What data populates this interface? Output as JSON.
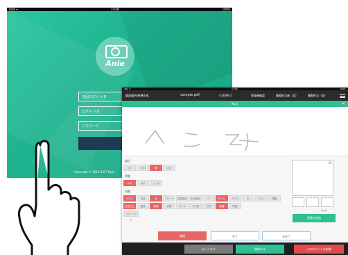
{
  "login": {
    "status_time": "14:08",
    "status_left": "iPad ᯤ",
    "status_right": "100%",
    "logo_text": "Anie",
    "field1_placeholder": "前回ログインID",
    "field2_placeholder": "ログインID",
    "field3_placeholder": "パスワード",
    "login_button": "ログイ",
    "copyright": "Copyright © 2015-2017 Kyoc"
  },
  "app": {
    "status_left": "iPad ᯤ",
    "status_time": "14:06",
    "status_right": "100%",
    "header": {
      "back_label": "図面選択/新規作成",
      "file_name": "sample.pdf",
      "page_indicator": "《 40/99 》",
      "item_a": "登録者確認",
      "item_b": "業務担当者（全）",
      "item_c": "複数担当（全）"
    },
    "point_title": "No.1",
    "close_label": "✕",
    "handwriting_text": "へこみ",
    "sections": {
      "location_label": "部位",
      "location_chips": [
        "床",
        "巾木",
        "壁",
        "天井"
      ],
      "location_selected": 2,
      "state_label": "状態",
      "state_chips": [
        "キズ",
        "汚れ",
        "へこみ"
      ],
      "state_selected": 0,
      "material_label": "材質",
      "material_chips": [
        "クロス",
        "塗装",
        "木",
        "フローリング",
        "金属製品",
        "木製製品",
        "CF",
        "タイル",
        "ガラス",
        "石",
        "アルミ",
        "樹脂"
      ],
      "material_chips_row2": [
        "左官仕上",
        "建具",
        "家具",
        "設備",
        "タイル",
        "その他",
        "石膏",
        "磁器",
        "陶器"
      ],
      "material_selected": [
        0,
        2,
        7
      ],
      "extra_chip": "フローリング"
    },
    "photo": {
      "count_label": "• • • 全7枚",
      "add_button": "画像を追加"
    },
    "actions": {
      "confirm": "確認",
      "done": "完了",
      "undone": "未完了"
    },
    "footer": {
      "cancel": "キャンセル",
      "register": "登録する",
      "delete": "このポイントを削除"
    }
  },
  "colors": {
    "brand_green": "#2fbf92",
    "alert_red": "#e86666",
    "login_bg": "#1fb490"
  }
}
